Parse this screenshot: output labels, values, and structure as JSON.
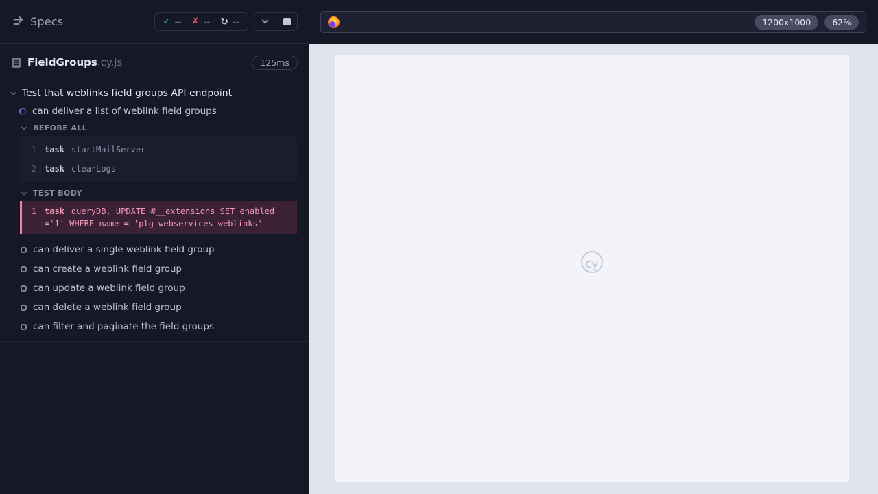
{
  "sidebar": {
    "title": "Specs",
    "stats": {
      "passed": "--",
      "failed": "--",
      "running": "--"
    },
    "spec_file": {
      "name": "FieldGroups",
      "ext": ".cy.js",
      "duration": "125ms"
    },
    "suite_title": "Test that weblinks field groups API endpoint",
    "running_test": "can deliver a list of weblink field groups",
    "before_all": {
      "label": "BEFORE ALL",
      "commands": [
        {
          "num": "1",
          "method": "task",
          "message": "startMailServer"
        },
        {
          "num": "2",
          "method": "task",
          "message": "clearLogs"
        }
      ]
    },
    "test_body": {
      "label": "TEST BODY",
      "commands": [
        {
          "num": "1",
          "method": "task",
          "message": "queryDB, UPDATE #__extensions SET enabled ='1' WHERE name = 'plg_webservices_weblinks'"
        }
      ]
    },
    "pending_tests": [
      "can deliver a single weblink field group",
      "can create a weblink field group",
      "can update a weblink field group",
      "can delete a weblink field group",
      "can filter and paginate the field groups"
    ]
  },
  "icons": {
    "check": "✓",
    "cross": "✗",
    "restart": "↻"
  },
  "urlbar": {
    "viewport_size": "1200x1000",
    "zoom": "62%"
  },
  "watermark": "cy",
  "colors": {
    "accent_pink": "#e884ab",
    "pass_green": "#2bc998",
    "fail_red": "#ef5a6a",
    "panel_bg": "#161826"
  }
}
